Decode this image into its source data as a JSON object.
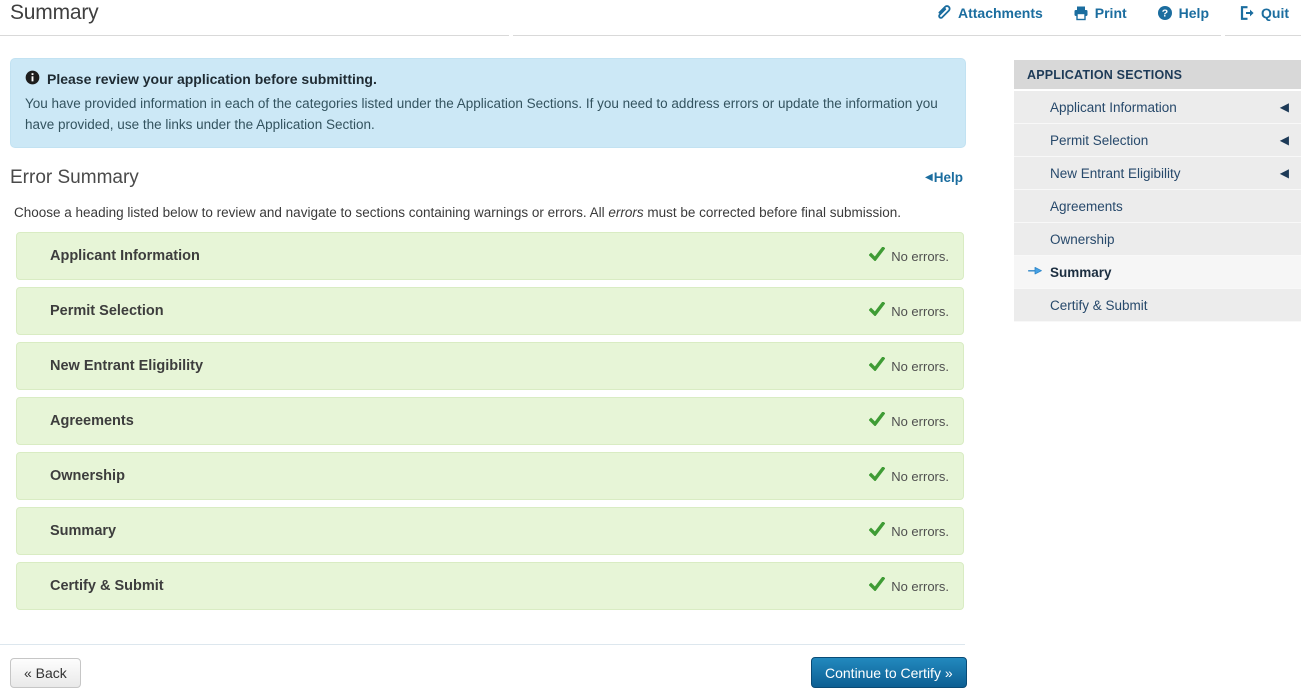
{
  "page": {
    "title": "Summary"
  },
  "toolbar": {
    "links": [
      {
        "label": "Attachments",
        "icon": "paperclip-icon"
      },
      {
        "label": "Print",
        "icon": "printer-icon"
      },
      {
        "label": "Help",
        "icon": "question-circle-icon"
      },
      {
        "label": "Quit",
        "icon": "sign-out-icon"
      }
    ]
  },
  "info_box": {
    "icon": "info-circle-icon",
    "title": "Please review your application before submitting.",
    "body": "You have provided information in each of the categories listed under the Application Sections. If you need to address errors or update the information you have provided, use the links under the Application Section."
  },
  "error_summary": {
    "heading": "Error Summary",
    "help_label": "Help",
    "instruction_prefix": "Choose a heading listed below to review and navigate to sections containing warnings or errors. All ",
    "instruction_italic": "errors",
    "instruction_suffix": " must be corrected before final submission.",
    "rows": [
      {
        "label": "Applicant Information",
        "status": "No errors."
      },
      {
        "label": "Permit Selection",
        "status": "No errors."
      },
      {
        "label": "New Entrant Eligibility",
        "status": "No errors."
      },
      {
        "label": "Agreements",
        "status": "No errors."
      },
      {
        "label": "Ownership",
        "status": "No errors."
      },
      {
        "label": "Summary",
        "status": "No errors."
      },
      {
        "label": "Certify & Submit",
        "status": "No errors."
      }
    ]
  },
  "sidebar": {
    "heading": "APPLICATION SECTIONS",
    "items": [
      {
        "label": "Applicant Information",
        "has_collapse_arrow": true,
        "active": false
      },
      {
        "label": "Permit Selection",
        "has_collapse_arrow": true,
        "active": false
      },
      {
        "label": "New Entrant Eligibility",
        "has_collapse_arrow": true,
        "active": false
      },
      {
        "label": "Agreements",
        "has_collapse_arrow": false,
        "active": false
      },
      {
        "label": "Ownership",
        "has_collapse_arrow": false,
        "active": false
      },
      {
        "label": "Summary",
        "has_collapse_arrow": false,
        "active": true
      },
      {
        "label": "Certify & Submit",
        "has_collapse_arrow": false,
        "active": false
      }
    ],
    "collapse_glyph": "◀"
  },
  "footer": {
    "back_label": "« Back",
    "continue_label": "Continue to Certify »"
  },
  "colors": {
    "link_blue": "#1b6d9f",
    "info_bg": "#cce8f6",
    "row_bg": "#e7f5d7",
    "row_border": "#d9ecc3",
    "check_green": "#3f9c35",
    "sidebar_header_bg": "#d8d8d8",
    "sidebar_item_bg": "#ececec",
    "sidebar_text": "#27496b",
    "active_arrow_blue": "#46a1e5",
    "continue_btn_top": "#2289be",
    "continue_btn_bottom": "#0d5f93"
  }
}
